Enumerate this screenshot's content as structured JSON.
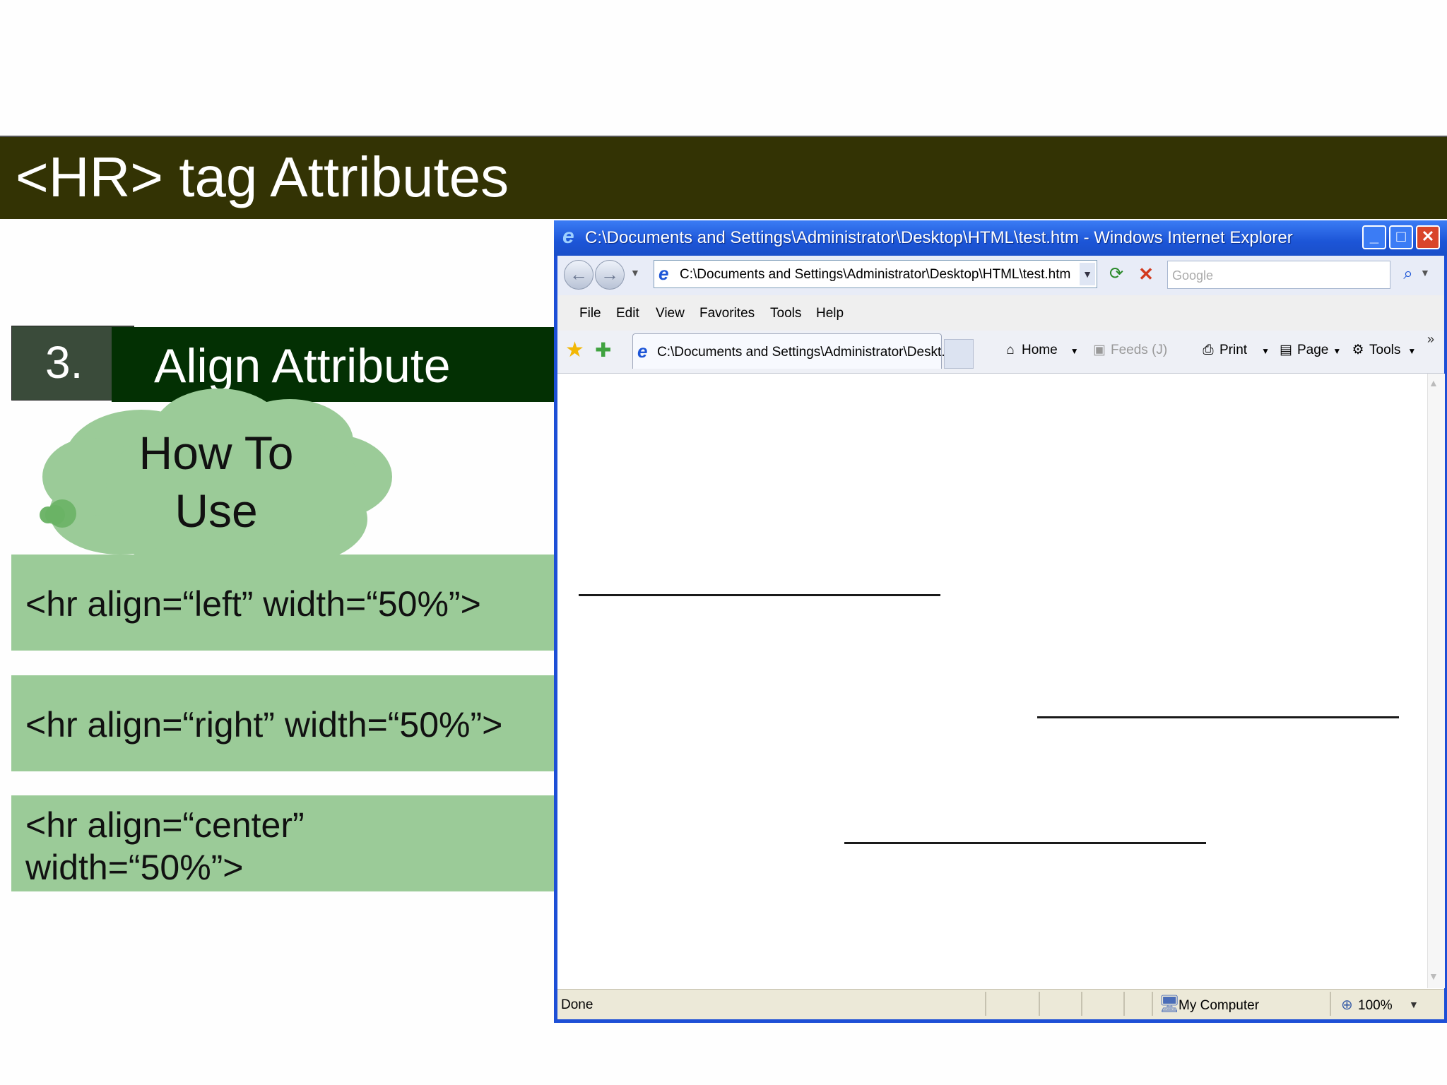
{
  "slide": {
    "title": "<HR> tag Attributes",
    "section_number": "3.",
    "section_title": "Align Attribute",
    "cloud_text": "How To Use",
    "code_examples": [
      "<hr align=“left” width=“50%”>",
      "<hr align=“right” width=“50%”>",
      "<hr align=“center” width=“50%”>"
    ]
  },
  "browser": {
    "window_title": "C:\\Documents and Settings\\Administrator\\Desktop\\HTML\\test.htm - Windows Internet Explorer",
    "address": "C:\\Documents and Settings\\Administrator\\Desktop\\HTML\\test.htm",
    "search_placeholder": "Google",
    "menu": [
      "File",
      "Edit",
      "View",
      "Favorites",
      "Tools",
      "Help"
    ],
    "tab_label": "C:\\Documents and Settings\\Administrator\\Deskt...",
    "command_bar": {
      "home": "Home",
      "feeds": "Feeds (J)",
      "print": "Print",
      "page": "Page",
      "tools": "Tools"
    },
    "content_hr_lines": [
      {
        "align": "left",
        "width_fraction": 0.5
      },
      {
        "align": "right",
        "width_fraction": 0.5
      },
      {
        "align": "center",
        "width_fraction": 0.5
      }
    ],
    "status": {
      "text": "Done",
      "zone": "My Computer",
      "zoom": "100%"
    }
  },
  "colors": {
    "title_bar": "#333304",
    "section_header": "#033003",
    "number_box": "#3a4b3a",
    "code_box": "#9bcb98",
    "cloud": "#9bcb98",
    "ie_blue": "#1d4fd6"
  },
  "icons": [
    "ie-logo-icon",
    "minimize-icon",
    "maximize-icon",
    "close-icon",
    "back-icon",
    "forward-icon",
    "refresh-icon",
    "stop-icon",
    "search-icon",
    "favorites-star-icon",
    "add-favorite-icon",
    "home-icon",
    "feeds-icon",
    "print-icon",
    "page-icon",
    "tools-gear-icon",
    "computer-icon",
    "zoom-icon"
  ]
}
